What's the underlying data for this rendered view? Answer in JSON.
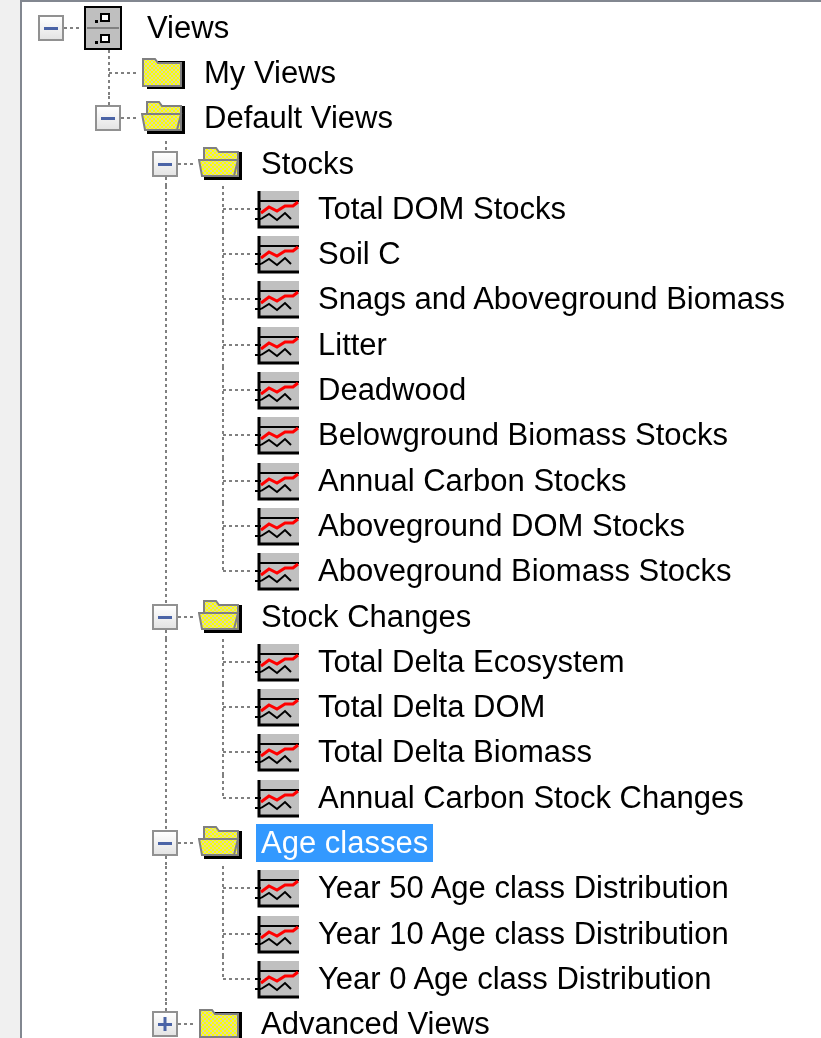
{
  "tree": {
    "root": {
      "label": "Views",
      "kind": "cabinet",
      "expanded": true,
      "selected": false,
      "children": [
        {
          "label": "My Views",
          "kind": "folder",
          "selected": false
        },
        {
          "label": "Default Views",
          "kind": "folder",
          "expanded": true,
          "selected": false,
          "children": [
            {
              "label": "Stocks",
              "kind": "folder",
              "expanded": true,
              "selected": false,
              "children": [
                {
                  "label": "Total DOM Stocks",
                  "kind": "chart",
                  "selected": false
                },
                {
                  "label": "Soil C",
                  "kind": "chart",
                  "selected": false
                },
                {
                  "label": "Snags and Aboveground Biomass",
                  "kind": "chart",
                  "selected": false
                },
                {
                  "label": "Litter",
                  "kind": "chart",
                  "selected": false
                },
                {
                  "label": "Deadwood",
                  "kind": "chart",
                  "selected": false
                },
                {
                  "label": "Belowground Biomass Stocks",
                  "kind": "chart",
                  "selected": false
                },
                {
                  "label": "Annual Carbon Stocks",
                  "kind": "chart",
                  "selected": false
                },
                {
                  "label": "Aboveground DOM Stocks",
                  "kind": "chart",
                  "selected": false
                },
                {
                  "label": "Aboveground Biomass Stocks",
                  "kind": "chart",
                  "selected": false
                }
              ]
            },
            {
              "label": "Stock Changes",
              "kind": "folder",
              "expanded": true,
              "selected": false,
              "children": [
                {
                  "label": "Total Delta Ecosystem",
                  "kind": "chart",
                  "selected": false
                },
                {
                  "label": "Total Delta DOM",
                  "kind": "chart",
                  "selected": false
                },
                {
                  "label": "Total Delta Biomass",
                  "kind": "chart",
                  "selected": false
                },
                {
                  "label": "Annual Carbon Stock Changes",
                  "kind": "chart",
                  "selected": false
                }
              ]
            },
            {
              "label": "Age classes",
              "kind": "folder",
              "expanded": true,
              "selected": true,
              "children": [
                {
                  "label": "Year 50 Age class Distribution",
                  "kind": "chart",
                  "selected": false
                },
                {
                  "label": "Year 10 Age class Distribution",
                  "kind": "chart",
                  "selected": false
                },
                {
                  "label": "Year 0 Age class Distribution",
                  "kind": "chart",
                  "selected": false
                }
              ]
            },
            {
              "label": "Advanced Views",
              "kind": "folder",
              "expanded": false,
              "selected": false
            }
          ]
        }
      ]
    }
  }
}
